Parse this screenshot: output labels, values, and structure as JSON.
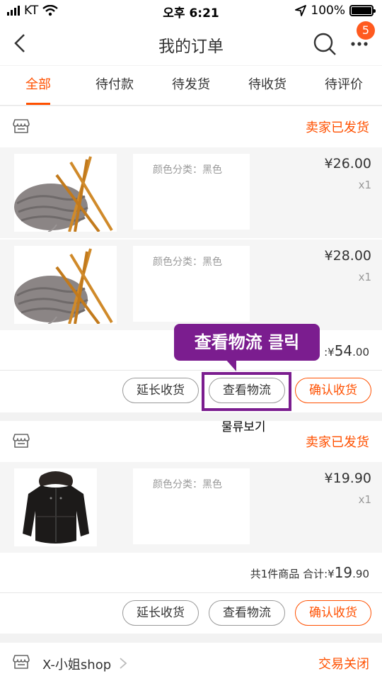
{
  "status_bar": {
    "carrier": "KT",
    "time": "오후 6:21",
    "battery": "100%"
  },
  "nav": {
    "title": "我的订单",
    "badge": "5"
  },
  "tabs": [
    "全部",
    "待付款",
    "待发货",
    "待收货",
    "待评价"
  ],
  "active_tab": 0,
  "orders": [
    {
      "status": "卖家已发货",
      "items": [
        {
          "spec": "颜色分类：黑色",
          "price": "¥26.00",
          "qty": "x1",
          "image": "yarn-knitting-needles"
        },
        {
          "spec": "颜色分类：黑色",
          "price": "¥28.00",
          "qty": "x1",
          "image": "yarn-knitting-needles"
        }
      ],
      "summary_tail": ":¥",
      "summary_big": "54",
      "summary_dec": ".00",
      "buttons": {
        "extend": "延长收货",
        "logistics": "查看物流",
        "confirm": "确认收货"
      }
    },
    {
      "status": "卖家已发货",
      "items": [
        {
          "spec": "颜色分类：黑色",
          "price": "¥19.90",
          "qty": "x1",
          "image": "black-winter-jacket"
        }
      ],
      "summary_prefix": "共1件商品 合计:¥",
      "summary_big": "19",
      "summary_dec": ".90",
      "buttons": {
        "extend": "延长收货",
        "logistics": "查看物流",
        "confirm": "确认收货"
      }
    },
    {
      "shop_name": "X-小姐shop",
      "status": "交易关闭"
    }
  ],
  "annotation": {
    "callout": "查看物流 클릭",
    "caption": "물류보기",
    "color": "#7b1d8f"
  },
  "colors": {
    "accent": "#ff5000",
    "badge": "#ff5a1f"
  }
}
